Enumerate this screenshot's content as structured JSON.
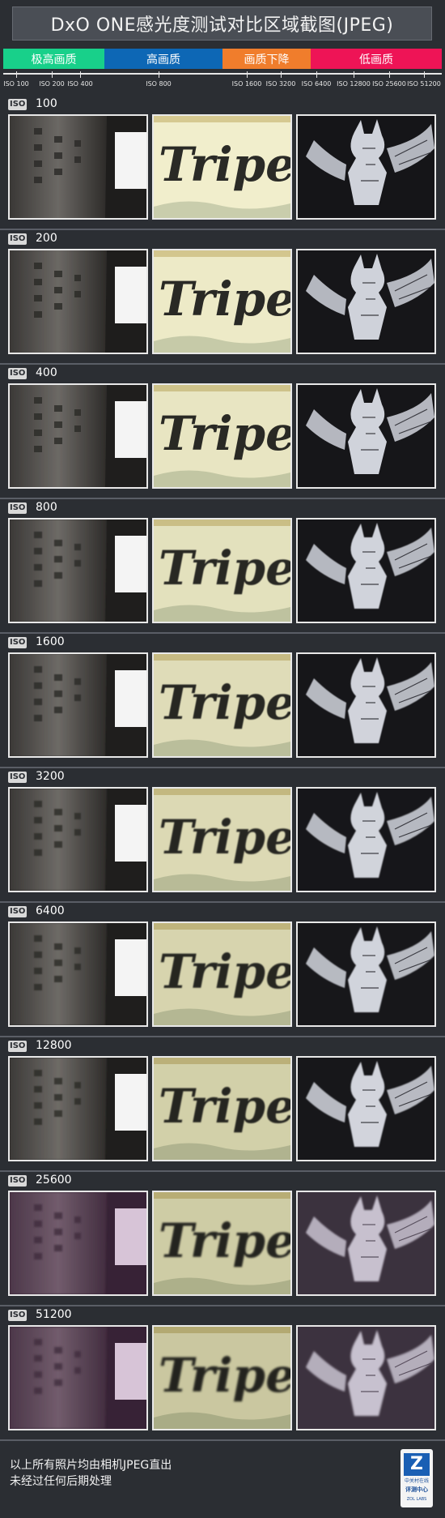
{
  "title": "DxO ONE感光度测试对比区域截图(JPEG)",
  "bands": [
    "极高画质",
    "高画质",
    "画质下降",
    "低画质"
  ],
  "scale_labels": [
    "ISO 100",
    "ISO 200",
    "ISO 400",
    "ISO 800",
    "ISO 1600",
    "ISO 3200",
    "ISO 6400",
    "ISO 12800",
    "ISO 25600",
    "ISO 51200"
  ],
  "iso_tag": "ISO",
  "rows": [
    {
      "iso": "100"
    },
    {
      "iso": "200"
    },
    {
      "iso": "400"
    },
    {
      "iso": "800"
    },
    {
      "iso": "1600"
    },
    {
      "iso": "3200"
    },
    {
      "iso": "6400"
    },
    {
      "iso": "12800"
    },
    {
      "iso": "25600"
    },
    {
      "iso": "51200"
    }
  ],
  "crop_text": "Tripe",
  "footer": {
    "line1": "以上所有照片均由相机JPEG直出",
    "line2": "未经过任何后期处理"
  },
  "logo": {
    "letter": "Z",
    "line1": "中关村在线",
    "line2": "评测中心",
    "line3": "ZOL LABS"
  },
  "colors": {
    "excellent": "#18d08a",
    "high": "#0d67b5",
    "declining": "#f07d2c",
    "low": "#ee1456"
  }
}
